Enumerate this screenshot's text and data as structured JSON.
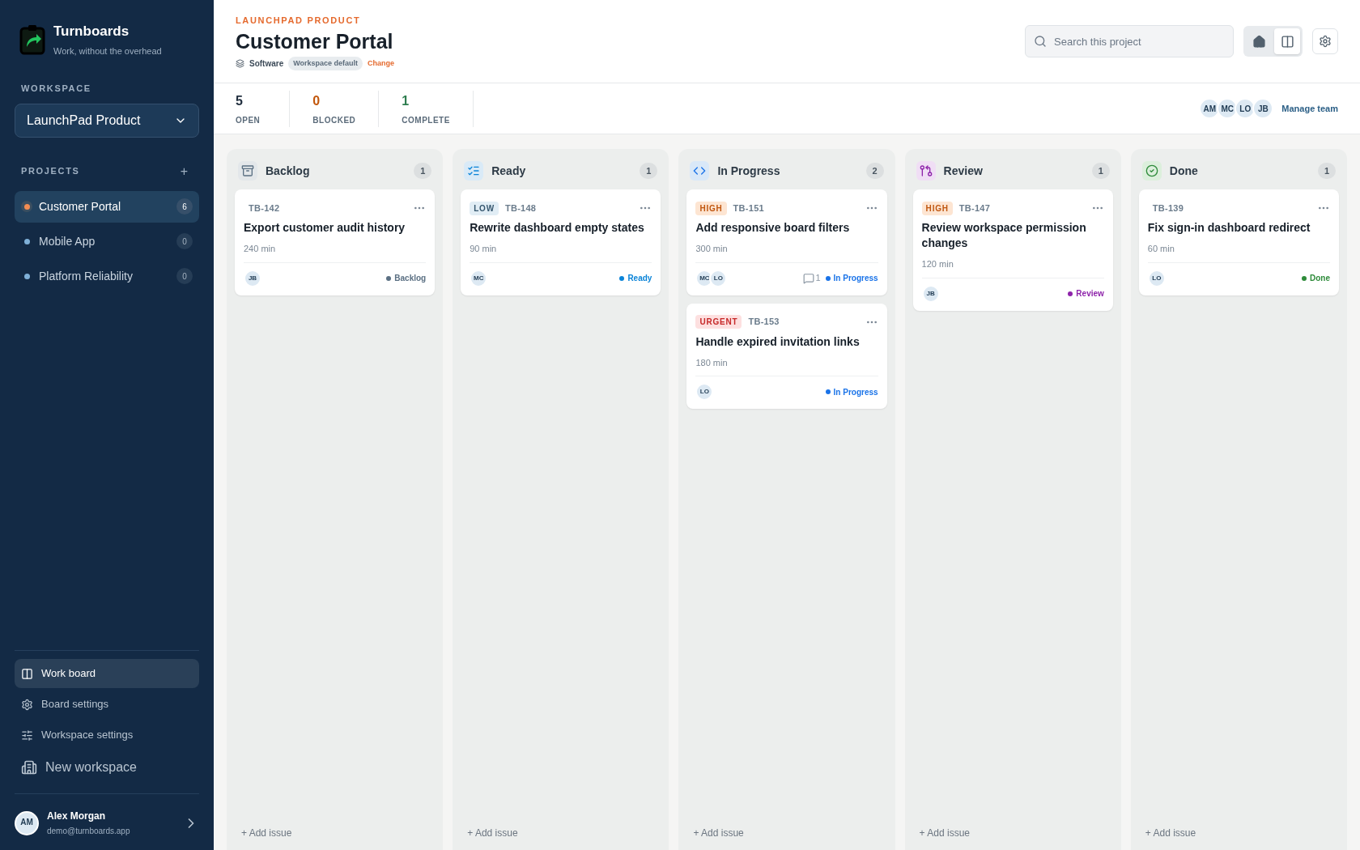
{
  "brand": {
    "name": "Turnboards",
    "tagline": "Work, without the overhead"
  },
  "workspace": {
    "label": "WORKSPACE",
    "value": "LaunchPad Product"
  },
  "projects": {
    "label": "PROJECTS",
    "add": "+",
    "items": [
      {
        "name": "Customer Portal",
        "count": "6",
        "selected": true,
        "color": "#f28c52"
      },
      {
        "name": "Mobile App",
        "count": "0",
        "selected": false,
        "color": "#7fb0d8"
      },
      {
        "name": "Platform Reliability",
        "count": "0",
        "selected": false,
        "color": "#7fb0d8"
      }
    ]
  },
  "nav": [
    {
      "label": "Work board",
      "kind": "board",
      "selected": true
    },
    {
      "label": "Board settings",
      "kind": "gear",
      "selected": false
    },
    {
      "label": "Workspace settings",
      "kind": "sliders",
      "selected": false
    },
    {
      "label": "New workspace",
      "kind": "building",
      "selected": false
    }
  ],
  "user": {
    "initials": "AM",
    "name": "Alex Morgan",
    "email": "demo@turnboards.app"
  },
  "header": {
    "eyebrow": "LAUNCHPAD PRODUCT",
    "title": "Customer Portal",
    "type": "Software",
    "badge": "Workspace default",
    "change": "Change"
  },
  "search": {
    "placeholder": "Search this project"
  },
  "view_toggle": [
    {
      "kind": "home",
      "selected": false
    },
    {
      "kind": "board",
      "selected": true
    }
  ],
  "stats": [
    {
      "value": "5",
      "label": "OPEN",
      "color": "#1f2d3d"
    },
    {
      "value": "0",
      "label": "BLOCKED",
      "color": "#c2570c"
    },
    {
      "value": "1",
      "label": "COMPLETE",
      "color": "#2e7d4f"
    }
  ],
  "team": {
    "members": [
      "AM",
      "MC",
      "LO",
      "JB"
    ],
    "link": "Manage team"
  },
  "columns": [
    {
      "title": "Backlog",
      "kind": "backlog",
      "count": "1",
      "add": "+ Add issue",
      "cards": [
        {
          "key": "TB-142",
          "title": "Export customer audit history",
          "estimate": "240 min",
          "assignees": [
            "JB"
          ],
          "status": "Backlog",
          "color": "#5b7083"
        }
      ]
    },
    {
      "title": "Ready",
      "kind": "ready",
      "count": "1",
      "add": "+ Add issue",
      "cards": [
        {
          "priority": {
            "label": "LOW",
            "kind": "low"
          },
          "key": "TB-148",
          "title": "Rewrite dashboard empty states",
          "estimate": "90 min",
          "assignees": [
            "MC"
          ],
          "status": "Ready",
          "color": "#0b84d8"
        }
      ]
    },
    {
      "title": "In Progress",
      "kind": "progress",
      "count": "2",
      "add": "+ Add issue",
      "cards": [
        {
          "priority": {
            "label": "HIGH",
            "kind": "high"
          },
          "key": "TB-151",
          "title": "Add responsive board filters",
          "estimate": "300 min",
          "assignees": [
            "MC",
            "LO"
          ],
          "comments": "1",
          "status": "In Progress",
          "color": "#1a73e8"
        },
        {
          "priority": {
            "label": "URGENT",
            "kind": "urgent"
          },
          "key": "TB-153",
          "title": "Handle expired invitation links",
          "estimate": "180 min",
          "assignees": [
            "LO"
          ],
          "status": "In Progress",
          "color": "#1a73e8"
        }
      ]
    },
    {
      "title": "Review",
      "kind": "review",
      "count": "1",
      "add": "+ Add issue",
      "cards": [
        {
          "priority": {
            "label": "HIGH",
            "kind": "high"
          },
          "key": "TB-147",
          "title": "Review workspace permission changes",
          "estimate": "120 min",
          "assignees": [
            "JB"
          ],
          "status": "Review",
          "color": "#8e24aa"
        }
      ]
    },
    {
      "title": "Done",
      "kind": "done",
      "count": "1",
      "add": "+ Add issue",
      "cards": [
        {
          "key": "TB-139",
          "title": "Fix sign-in dashboard redirect",
          "estimate": "60 min",
          "assignees": [
            "LO"
          ],
          "status": "Done",
          "color": "#2e8b3a"
        }
      ]
    }
  ]
}
